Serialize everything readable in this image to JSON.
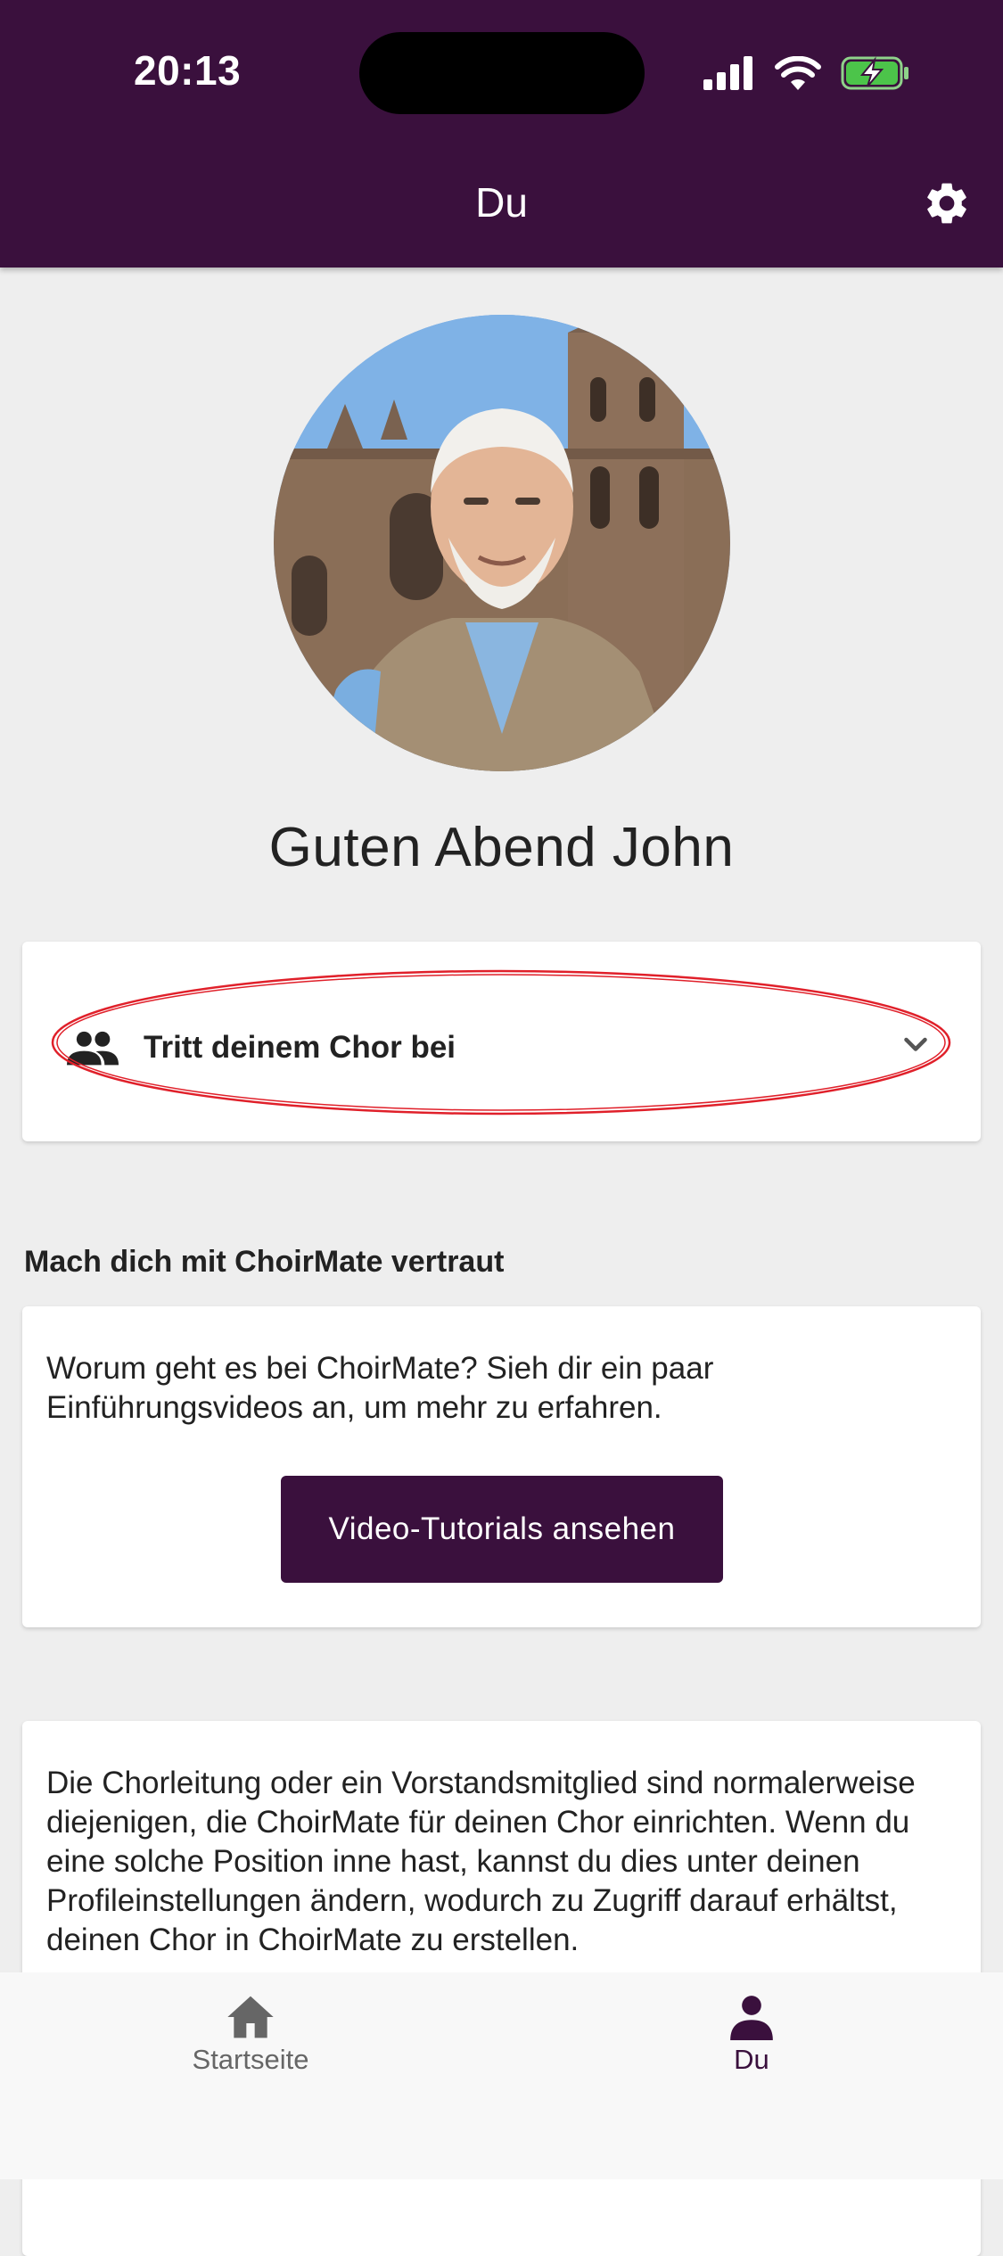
{
  "status_bar": {
    "time": "20:13"
  },
  "header": {
    "title": "Du"
  },
  "profile": {
    "greeting": "Guten Abend John"
  },
  "join_choir": {
    "label": "Tritt deinem Chor bei"
  },
  "tutorial_section": {
    "heading": "Mach dich mit ChoirMate vertraut",
    "text": "Worum geht es bei ChoirMate? Sieh dir ein paar Einführungsvideos an, um mehr zu erfahren.",
    "button_label": "Video-Tutorials ansehen"
  },
  "info_card": {
    "text": "Die Chorleitung oder ein Vorstandsmitglied sind normalerweise diejenigen, die ChoirMate für deinen Chor einrichten. Wenn du eine solche Position inne hast, kannst du dies unter deinen Profileinstellungen ändern, wodurch zu Zugriff darauf erhältst, deinen Chor in ChoirMate zu erstellen."
  },
  "bottom_nav": {
    "items": [
      {
        "label": "Startseite",
        "icon": "home-icon",
        "active": false
      },
      {
        "label": "Du",
        "icon": "person-icon",
        "active": true
      }
    ]
  },
  "colors": {
    "brand": "#3a103d",
    "background": "#eeeeee",
    "highlight": "#e0202a"
  }
}
